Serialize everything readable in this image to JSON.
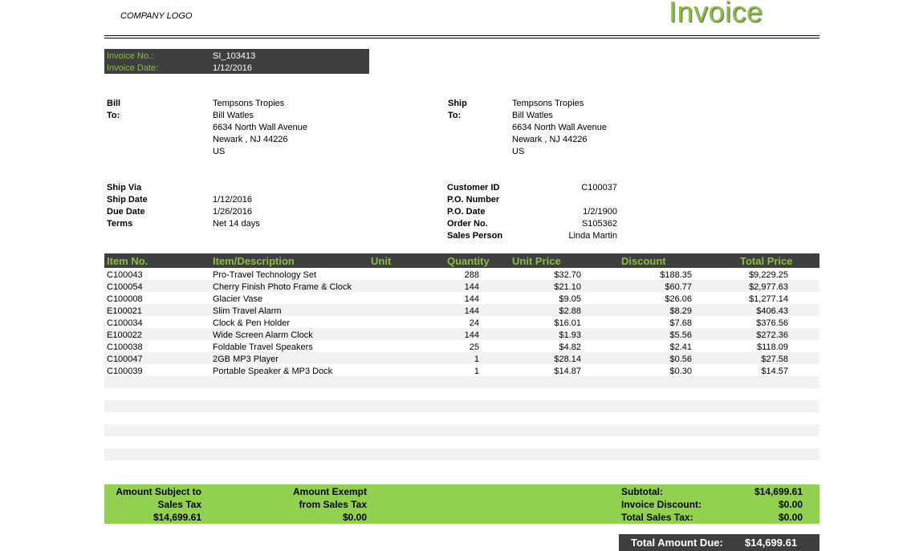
{
  "header": {
    "logo_text": "COMPANY LOGO",
    "title": "Invoice"
  },
  "meta": {
    "invoice_no_label": "Invoice No.:",
    "invoice_no": "SI_103413",
    "invoice_date_label": "Invoice Date:",
    "invoice_date": "1/12/2016"
  },
  "bill": {
    "label1": "Bill",
    "label2": "To:",
    "lines": [
      "Tempsons Tropies",
      "Bill Watles",
      "6634 North Wall Avenue",
      "Newark , NJ  44226",
      "US"
    ]
  },
  "ship": {
    "label1": "Ship",
    "label2": "To:",
    "lines": [
      "Tempsons Tropies",
      "Bill Watles",
      "6634 North Wall Avenue",
      "Newark , NJ  44226",
      "US"
    ]
  },
  "shipping": {
    "ship_via_label": "Ship Via",
    "ship_via": "",
    "ship_date_label": "Ship Date",
    "ship_date": "1/12/2016",
    "due_date_label": "Due Date",
    "due_date": "1/26/2016",
    "terms_label": "Terms",
    "terms": "Net 14 days"
  },
  "customer": {
    "customer_id_label": "Customer ID",
    "customer_id": "C100037",
    "po_number_label": "P.O. Number",
    "po_number": "",
    "po_date_label": "P.O. Date",
    "po_date": "1/2/1900",
    "order_no_label": "Order No.",
    "order_no": "S105362",
    "sales_person_label": "Sales Person",
    "sales_person": "Linda Martin"
  },
  "table": {
    "headers": [
      "Item No.",
      "Item/Description",
      "Unit",
      "Quantity",
      "Unit Price",
      "Discount",
      "Total Price"
    ],
    "rows": [
      {
        "item": "C100043",
        "desc": "Pro-Travel Technology Set",
        "unit": "",
        "qty": "288",
        "price": "$32.70",
        "discount": "$188.35",
        "total": "$9,229.25"
      },
      {
        "item": "C100054",
        "desc": "Cherry Finish Photo Frame & Clock",
        "unit": "",
        "qty": "144",
        "price": "$21.10",
        "discount": "$60.77",
        "total": "$2,977.63"
      },
      {
        "item": "C100008",
        "desc": "Glacier Vase",
        "unit": "",
        "qty": "144",
        "price": "$9.05",
        "discount": "$26.06",
        "total": "$1,277.14"
      },
      {
        "item": "E100021",
        "desc": "Slim Travel Alarm",
        "unit": "",
        "qty": "144",
        "price": "$2.88",
        "discount": "$8.29",
        "total": "$406.43"
      },
      {
        "item": "C100034",
        "desc": "Clock & Pen Holder",
        "unit": "",
        "qty": "24",
        "price": "$16.01",
        "discount": "$7.68",
        "total": "$376.56"
      },
      {
        "item": "E100022",
        "desc": "Wide Screen Alarm Clock",
        "unit": "",
        "qty": "144",
        "price": "$1.93",
        "discount": "$5.56",
        "total": "$272.36"
      },
      {
        "item": "C100038",
        "desc": "Foldable Travel Speakers",
        "unit": "",
        "qty": "25",
        "price": "$4.82",
        "discount": "$2.41",
        "total": "$118.09"
      },
      {
        "item": "C100047",
        "desc": "2GB MP3 Player",
        "unit": "",
        "qty": "1",
        "price": "$28.14",
        "discount": "$0.56",
        "total": "$27.58"
      },
      {
        "item": "C100039",
        "desc": "Portable Speaker & MP3 Dock",
        "unit": "",
        "qty": "1",
        "price": "$14.87",
        "discount": "$0.30",
        "total": "$14.57"
      }
    ]
  },
  "summary": {
    "taxable_label1": "Amount Subject to",
    "taxable_label2": "Sales Tax",
    "taxable_value": "$14,699.61",
    "exempt_label1": "Amount Exempt",
    "exempt_label2": "from Sales Tax",
    "exempt_value": "$0.00",
    "subtotal_label": "Subtotal:",
    "subtotal": "$14,699.61",
    "discount_label": "Invoice Discount:",
    "discount": "$0.00",
    "tax_label": "Total Sales Tax:",
    "tax": "$0.00",
    "total_label": "Total Amount Due:",
    "total": "$14,699.61"
  },
  "colors": {
    "accent_green": "#8cbf3f",
    "summary_green": "#92d050",
    "dark_bar": "#3f3f3f"
  }
}
